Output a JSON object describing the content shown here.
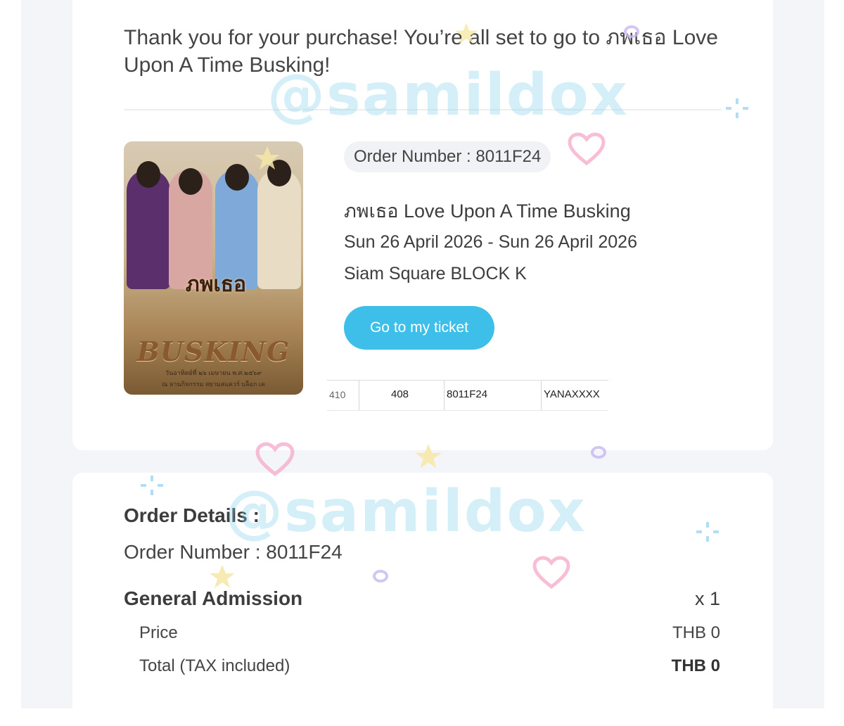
{
  "confirmation": {
    "message": "Thank you for your purchase! You’re all set to go to ภพเธอ Love Upon A Time Busking!"
  },
  "poster": {
    "logo_text": "ภพเธอ",
    "title_text": "BUSKING",
    "sub_line1": "วันอาทิตย์ที่ ๒๖ เมษายน พ.ศ.๒๕๖๙",
    "sub_line2": "ณ ลานกิจกรรม สยามสแควร์ บล็อก เค"
  },
  "ticket": {
    "order_pill": "Order Number : 8011F24",
    "event_title": "ภพเธอ Love Upon A Time Busking",
    "date_range": "Sun 26 April 2026 - Sun 26 April 2026",
    "venue": "Siam Square BLOCK K",
    "button_label": "Go to my ticket"
  },
  "strip": {
    "cells": [
      "410",
      "408",
      "8011F24",
      "YANAXXXX"
    ]
  },
  "order_details": {
    "title": "Order Details :",
    "order_number": "Order Number : 8011F24",
    "item_name": "General Admission",
    "quantity": "x 1",
    "price_label": "Price",
    "price_value": "THB 0",
    "total_label": "Total (TAX included)",
    "total_value": "THB 0"
  },
  "watermark": {
    "text": "@samildox"
  },
  "colors": {
    "accent_button": "#3dbfea",
    "page_background": "#f3f5f9",
    "card_background": "#ffffff"
  }
}
